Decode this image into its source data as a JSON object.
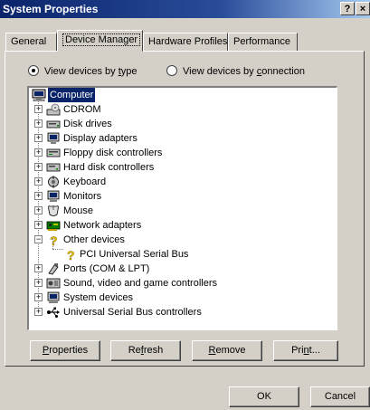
{
  "window": {
    "title": "System Properties",
    "help_glyph": "?",
    "close_glyph": "×"
  },
  "tabs": [
    "General",
    "Device Manager",
    "Hardware Profiles",
    "Performance"
  ],
  "active_tab": "Device Manager",
  "view": {
    "by_type_pre": "View devices by ",
    "by_type_key": "t",
    "by_type_post": "ype",
    "by_conn_pre": "View devices by ",
    "by_conn_key": "c",
    "by_conn_post": "onnection",
    "selected": "type"
  },
  "tree": {
    "root": {
      "label": "Computer",
      "icon": "computer-icon"
    },
    "items": [
      {
        "label": "CDROM",
        "icon": "cdrom-icon",
        "state": "collapsed"
      },
      {
        "label": "Disk drives",
        "icon": "disk-drive-icon",
        "state": "collapsed"
      },
      {
        "label": "Display adapters",
        "icon": "display-adapter-icon",
        "state": "collapsed"
      },
      {
        "label": "Floppy disk controllers",
        "icon": "floppy-controller-icon",
        "state": "collapsed"
      },
      {
        "label": "Hard disk controllers",
        "icon": "hard-disk-controller-icon",
        "state": "collapsed"
      },
      {
        "label": "Keyboard",
        "icon": "keyboard-icon",
        "state": "collapsed"
      },
      {
        "label": "Monitors",
        "icon": "monitor-icon",
        "state": "collapsed"
      },
      {
        "label": "Mouse",
        "icon": "mouse-icon",
        "state": "collapsed"
      },
      {
        "label": "Network adapters",
        "icon": "network-adapter-icon",
        "state": "collapsed"
      },
      {
        "label": "Other devices",
        "icon": "question-mark-icon",
        "state": "expanded"
      },
      {
        "label": "PCI Universal Serial Bus",
        "icon": "question-mark-icon",
        "state": "child"
      },
      {
        "label": "Ports (COM & LPT)",
        "icon": "port-icon",
        "state": "collapsed"
      },
      {
        "label": "Sound, video and game controllers",
        "icon": "sound-controller-icon",
        "state": "collapsed"
      },
      {
        "label": "System devices",
        "icon": "system-devices-icon",
        "state": "collapsed"
      },
      {
        "label": "Universal Serial Bus controllers",
        "icon": "usb-controller-icon",
        "state": "collapsed"
      }
    ]
  },
  "buttons": {
    "properties": {
      "pre": "",
      "key": "P",
      "post": "roperties"
    },
    "refresh": {
      "pre": "Re",
      "key": "f",
      "post": "resh"
    },
    "remove": {
      "pre": "",
      "key": "R",
      "post": "emove"
    },
    "print": {
      "pre": "Pri",
      "key": "n",
      "post": "t..."
    },
    "ok": "OK",
    "cancel": "Cancel"
  },
  "colors": {
    "title_bar": "#0a246a",
    "face": "#d4d0c8",
    "selection": "#0a246a"
  }
}
